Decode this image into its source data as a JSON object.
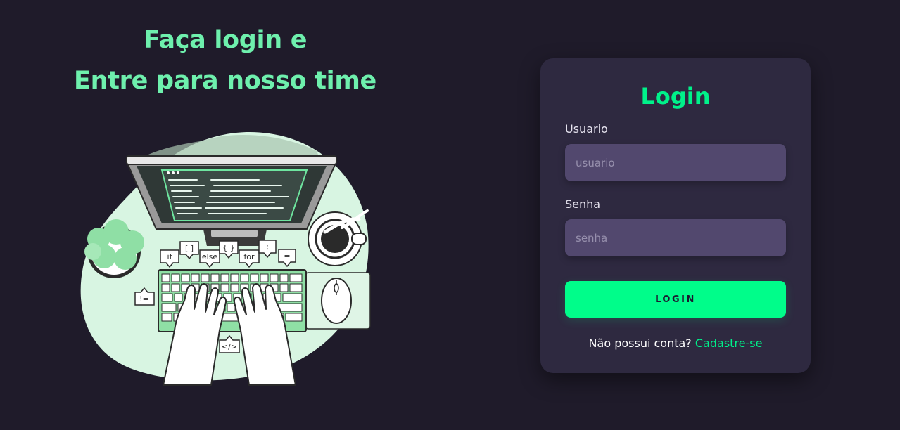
{
  "hero": {
    "title_line1": "Faça login e",
    "title_line2": "Entre para nosso time"
  },
  "illustration": {
    "icon": "developer-coding-illustration",
    "bubbles": [
      "if",
      "[ ]",
      "else",
      "{ }",
      "for",
      ";",
      "=",
      "!=",
      "</>"
    ]
  },
  "login": {
    "title": "Login",
    "username_label": "Usuario",
    "username_placeholder": "usuario",
    "username_value": "",
    "password_label": "Senha",
    "password_placeholder": "senha",
    "password_value": "",
    "button_label": "LOGIN",
    "signup_prompt": "Não possui conta?",
    "signup_link": "Cadastre-se"
  },
  "colors": {
    "background": "#1f1b2a",
    "card": "#2e2940",
    "input": "#52486e",
    "accent": "#00fd8a",
    "hero_text": "#6ef0ad"
  }
}
